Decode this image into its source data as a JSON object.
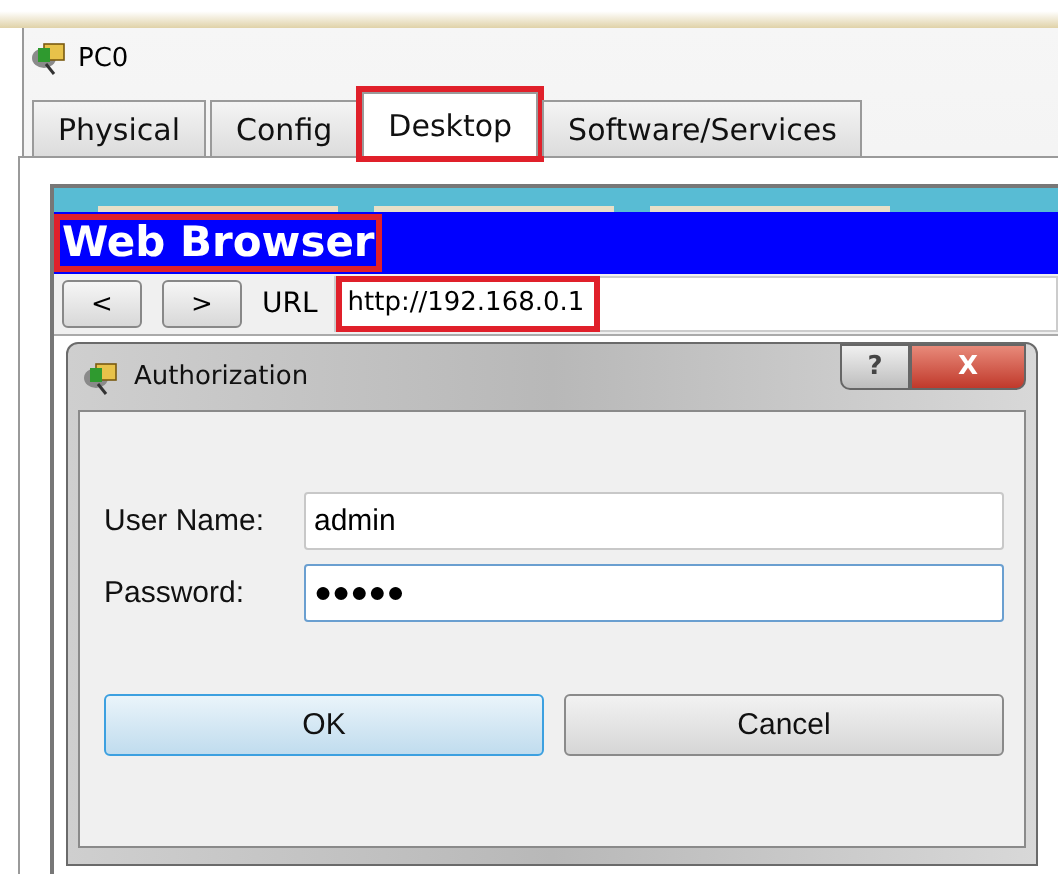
{
  "window": {
    "title": "PC0"
  },
  "tabs": [
    {
      "label": "Physical",
      "selected": false,
      "highlighted": false
    },
    {
      "label": "Config",
      "selected": false,
      "highlighted": false
    },
    {
      "label": "Desktop",
      "selected": true,
      "highlighted": true
    },
    {
      "label": "Software/Services",
      "selected": false,
      "highlighted": false
    }
  ],
  "browser": {
    "title": "Web Browser",
    "title_highlighted": true,
    "back_button": "<",
    "forward_button": ">",
    "url_label": "URL",
    "url": "http://192.168.0.1",
    "url_highlighted": true
  },
  "dialog": {
    "title": "Authorization",
    "help_button": "?",
    "close_button": "X",
    "fields": [
      {
        "label": "User Name:",
        "value": "admin",
        "focused": false
      },
      {
        "label": "Password:",
        "value": "●●●●●",
        "focused": true
      }
    ],
    "buttons": [
      {
        "label": "OK",
        "default": true
      },
      {
        "label": "Cancel",
        "default": false
      }
    ]
  }
}
